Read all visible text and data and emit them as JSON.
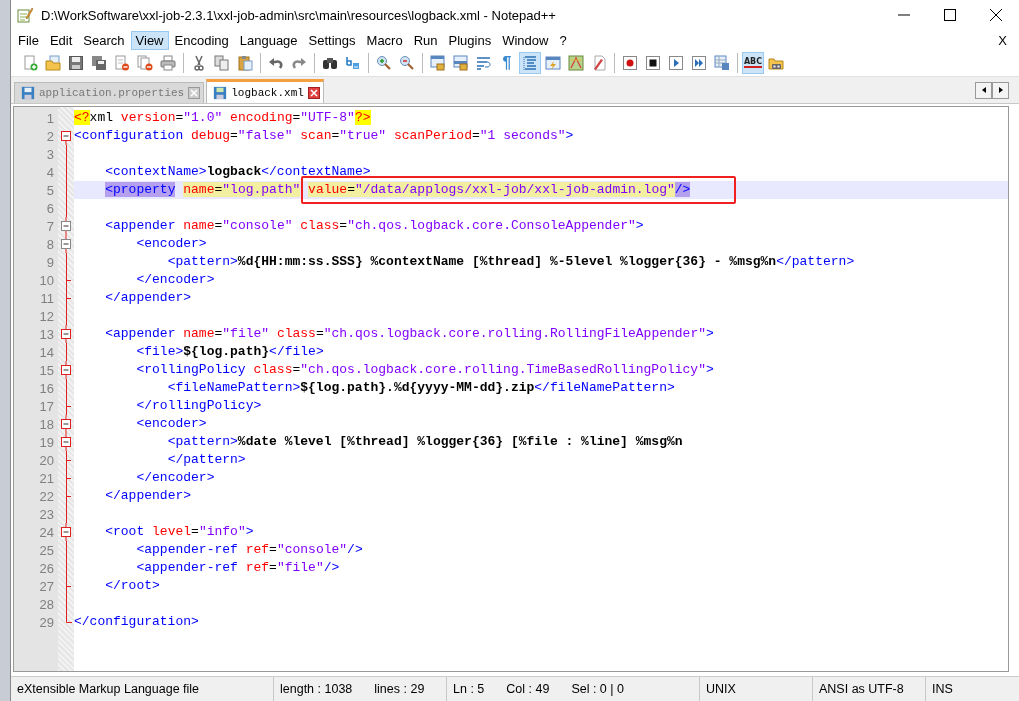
{
  "window": {
    "title": "D:\\WorkSoftware\\xxl-job-2.3.1\\xxl-job-admin\\src\\main\\resources\\logback.xml - Notepad++"
  },
  "menu": [
    {
      "label": "File",
      "selected": false
    },
    {
      "label": "Edit",
      "selected": false
    },
    {
      "label": "Search",
      "selected": false
    },
    {
      "label": "View",
      "selected": true
    },
    {
      "label": "Encoding",
      "selected": false
    },
    {
      "label": "Language",
      "selected": false
    },
    {
      "label": "Settings",
      "selected": false
    },
    {
      "label": "Macro",
      "selected": false
    },
    {
      "label": "Run",
      "selected": false
    },
    {
      "label": "Plugins",
      "selected": false
    },
    {
      "label": "Window",
      "selected": false
    },
    {
      "label": "?",
      "selected": false
    }
  ],
  "menu_close": "X",
  "toolbar": [
    {
      "items": [
        {
          "pressed": false
        },
        {
          "pressed": false
        },
        {
          "pressed": false
        },
        {
          "pressed": false
        },
        {
          "pressed": false
        },
        {
          "pressed": false
        },
        {
          "pressed": false
        }
      ]
    },
    {
      "items": [
        {
          "pressed": false
        },
        {
          "pressed": false
        },
        {
          "pressed": false
        }
      ]
    },
    {
      "items": [
        {
          "pressed": false
        },
        {
          "pressed": false
        }
      ]
    },
    {
      "items": [
        {
          "pressed": false
        },
        {
          "pressed": false
        }
      ]
    },
    {
      "items": [
        {
          "pressed": false
        },
        {
          "pressed": false
        }
      ]
    },
    {
      "items": [
        {
          "pressed": false
        },
        {
          "pressed": false
        },
        {
          "pressed": false
        },
        {
          "pressed": false,
          "glyph": "¶"
        },
        {
          "pressed": true
        },
        {
          "pressed": false
        },
        {
          "pressed": false
        },
        {
          "pressed": false
        }
      ]
    },
    {
      "items": [
        {
          "pressed": false
        },
        {
          "pressed": false
        },
        {
          "pressed": false
        },
        {
          "pressed": false
        },
        {
          "pressed": false
        }
      ]
    },
    {
      "items": [
        {
          "pressed": true,
          "glyph": "ABC"
        },
        {
          "pressed": false
        }
      ]
    }
  ],
  "tabs": [
    {
      "label": "application.properties",
      "selected": false
    },
    {
      "label": "logback.xml",
      "selected": true
    }
  ],
  "lines": [
    {
      "number": "1",
      "selected": false,
      "kind": "plain",
      "text": "<?xml version=\"1.0\" encoding=\"UTF-8\"?>"
    },
    {
      "number": "2",
      "selected": false,
      "kind": "open",
      "text": "<configuration debug=\"false\" scan=\"true\" scanPeriod=\"1 seconds\">"
    },
    {
      "number": "3",
      "selected": false,
      "kind": "inside"
    },
    {
      "number": "4",
      "selected": false,
      "kind": "inside",
      "text": "    <contextName>logback</contextName>"
    },
    {
      "number": "5",
      "selected": true,
      "kind": "inside",
      "text": "    <property name=\"log.path\" ",
      "framed": "value=\"/data/applogs/xxl-job/xxl-job-admin.log\"/>"
    },
    {
      "number": "6",
      "selected": false,
      "kind": "inside"
    },
    {
      "number": "7",
      "selected": false,
      "kind": "open",
      "text": "    <appender name=\"console\" class=\"ch.qos.logback.core.ConsoleAppender\">"
    },
    {
      "number": "8",
      "selected": false,
      "kind": "open",
      "text": "        <encoder>"
    },
    {
      "number": "9",
      "selected": false,
      "kind": "inside",
      "text": "            <pattern>%d{HH:mm:ss.SSS} %contextName [%thread] %-5level %logger{36} - %msg%n</pattern>"
    },
    {
      "number": "10",
      "selected": false,
      "kind": "close",
      "text": "        </encoder>"
    },
    {
      "number": "11",
      "selected": false,
      "kind": "close",
      "text": "    </appender>"
    },
    {
      "number": "12",
      "selected": false,
      "kind": "inside"
    },
    {
      "number": "13",
      "selected": false,
      "kind": "open",
      "text": "    <appender name=\"file\" class=\"ch.qos.logback.core.rolling.RollingFileAppender\">"
    },
    {
      "number": "14",
      "selected": false,
      "kind": "inside",
      "text": "        <file>${log.path}</file>"
    },
    {
      "number": "15",
      "selected": false,
      "kind": "open",
      "text": "        <rollingPolicy class=\"ch.qos.logback.core.rolling.TimeBasedRollingPolicy\">"
    },
    {
      "number": "16",
      "selected": false,
      "kind": "inside",
      "text": "            <fileNamePattern>${log.path}.%d{yyyy-MM-dd}.zip</fileNamePattern>"
    },
    {
      "number": "17",
      "selected": false,
      "kind": "close",
      "text": "        </rollingPolicy>"
    },
    {
      "number": "18",
      "selected": false,
      "kind": "open",
      "text": "        <encoder>"
    },
    {
      "number": "19",
      "selected": false,
      "kind": "open",
      "text": "            <pattern>%date %level [%thread] %logger{36} [%file : %line] %msg%n"
    },
    {
      "number": "20",
      "selected": false,
      "kind": "close",
      "text": "            </pattern>"
    },
    {
      "number": "21",
      "selected": false,
      "kind": "close",
      "text": "        </encoder>"
    },
    {
      "number": "22",
      "selected": false,
      "kind": "close",
      "text": "    </appender>"
    },
    {
      "number": "23",
      "selected": false,
      "kind": "inside"
    },
    {
      "number": "24",
      "selected": false,
      "kind": "open",
      "text": "    <root level=\"info\">"
    },
    {
      "number": "25",
      "selected": false,
      "kind": "inside",
      "text": "        <appender-ref ref=\"console\"/>"
    },
    {
      "number": "26",
      "selected": false,
      "kind": "inside",
      "text": "        <appender-ref ref=\"file\"/>"
    },
    {
      "number": "27",
      "selected": false,
      "kind": "close",
      "text": "    </root>"
    },
    {
      "number": "28",
      "selected": false,
      "kind": "inside"
    },
    {
      "number": "29",
      "selected": false,
      "kind": "end",
      "text": "</configuration>"
    }
  ],
  "status_bar": [
    {
      "kind": "wide",
      "texts": [
        "eXtensible Markup Language file"
      ]
    },
    {
      "kind": "mid",
      "texts": [
        "length : 1038",
        "lines : 29"
      ]
    },
    {
      "kind": "mid",
      "texts": [
        "Ln : 5",
        "Col : 49",
        "Sel : 0 | 0"
      ]
    },
    {
      "kind": "narrow",
      "texts": [
        "UNIX"
      ]
    },
    {
      "kind": "narrow",
      "texts": [
        "ANSI as UTF-8"
      ]
    },
    {
      "kind": "last",
      "texts": [
        "INS"
      ]
    }
  ]
}
